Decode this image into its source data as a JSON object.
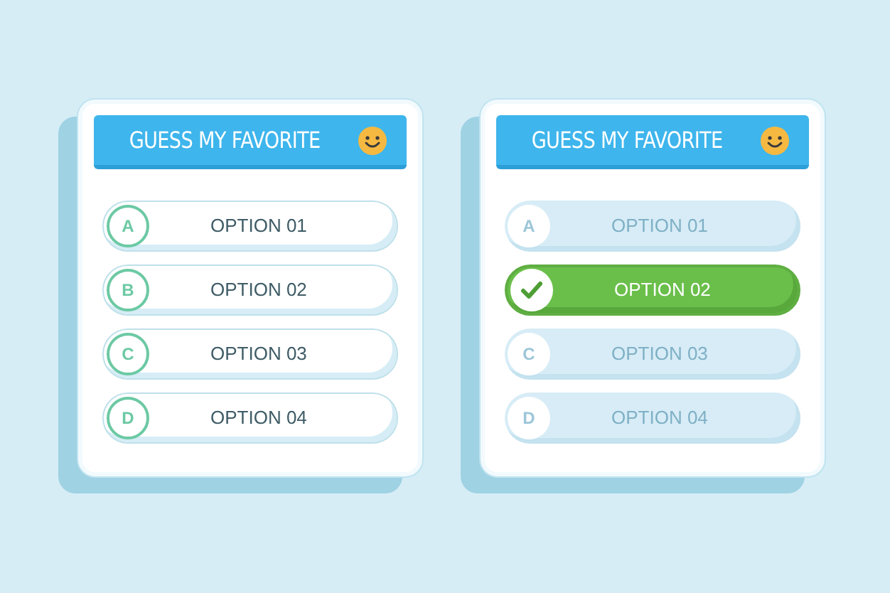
{
  "cards": [
    {
      "title": "GUESS MY FAVORITE",
      "answered": false,
      "options": [
        {
          "letter": "A",
          "label": "OPTION 01",
          "selected": false
        },
        {
          "letter": "B",
          "label": "OPTION 02",
          "selected": false
        },
        {
          "letter": "C",
          "label": "OPTION 03",
          "selected": false
        },
        {
          "letter": "D",
          "label": "OPTION 04",
          "selected": false
        }
      ]
    },
    {
      "title": "GUESS MY FAVORITE",
      "answered": true,
      "options": [
        {
          "letter": "A",
          "label": "OPTION 01",
          "selected": false
        },
        {
          "label": "OPTION 02",
          "selected": true
        },
        {
          "letter": "C",
          "label": "OPTION 03",
          "selected": false
        },
        {
          "letter": "D",
          "label": "OPTION 04",
          "selected": false
        }
      ]
    }
  ]
}
